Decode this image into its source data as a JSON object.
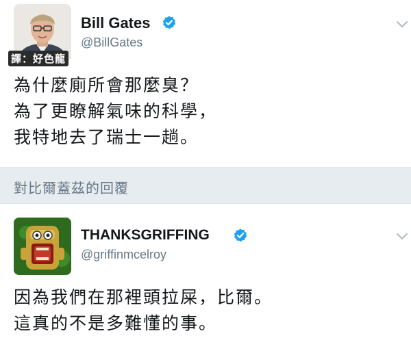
{
  "tweets": [
    {
      "name": "Bill Gates",
      "handle": "@BillGates",
      "verified": true,
      "translator_credit": "譯：好色龍",
      "lines": [
        "為什麼廁所會那麼臭？",
        "為了更瞭解氣味的科學，",
        "我特地去了瑞士一趟。"
      ]
    },
    {
      "name": "THANKSGRIFFING",
      "handle": "@griffinmcelroy",
      "verified": true,
      "lines": [
        "因為我們在那裡頭拉屎，比爾。",
        "這真的不是多難懂的事。"
      ]
    }
  ],
  "reply_context": "對比爾蓋茲的回覆",
  "colors": {
    "verified_blue": "#1da1f2",
    "secondary_text": "#657786",
    "reply_bar_bg": "#e6ecf0"
  },
  "icons": [
    "verified-badge-icon",
    "chevron-down-icon"
  ]
}
